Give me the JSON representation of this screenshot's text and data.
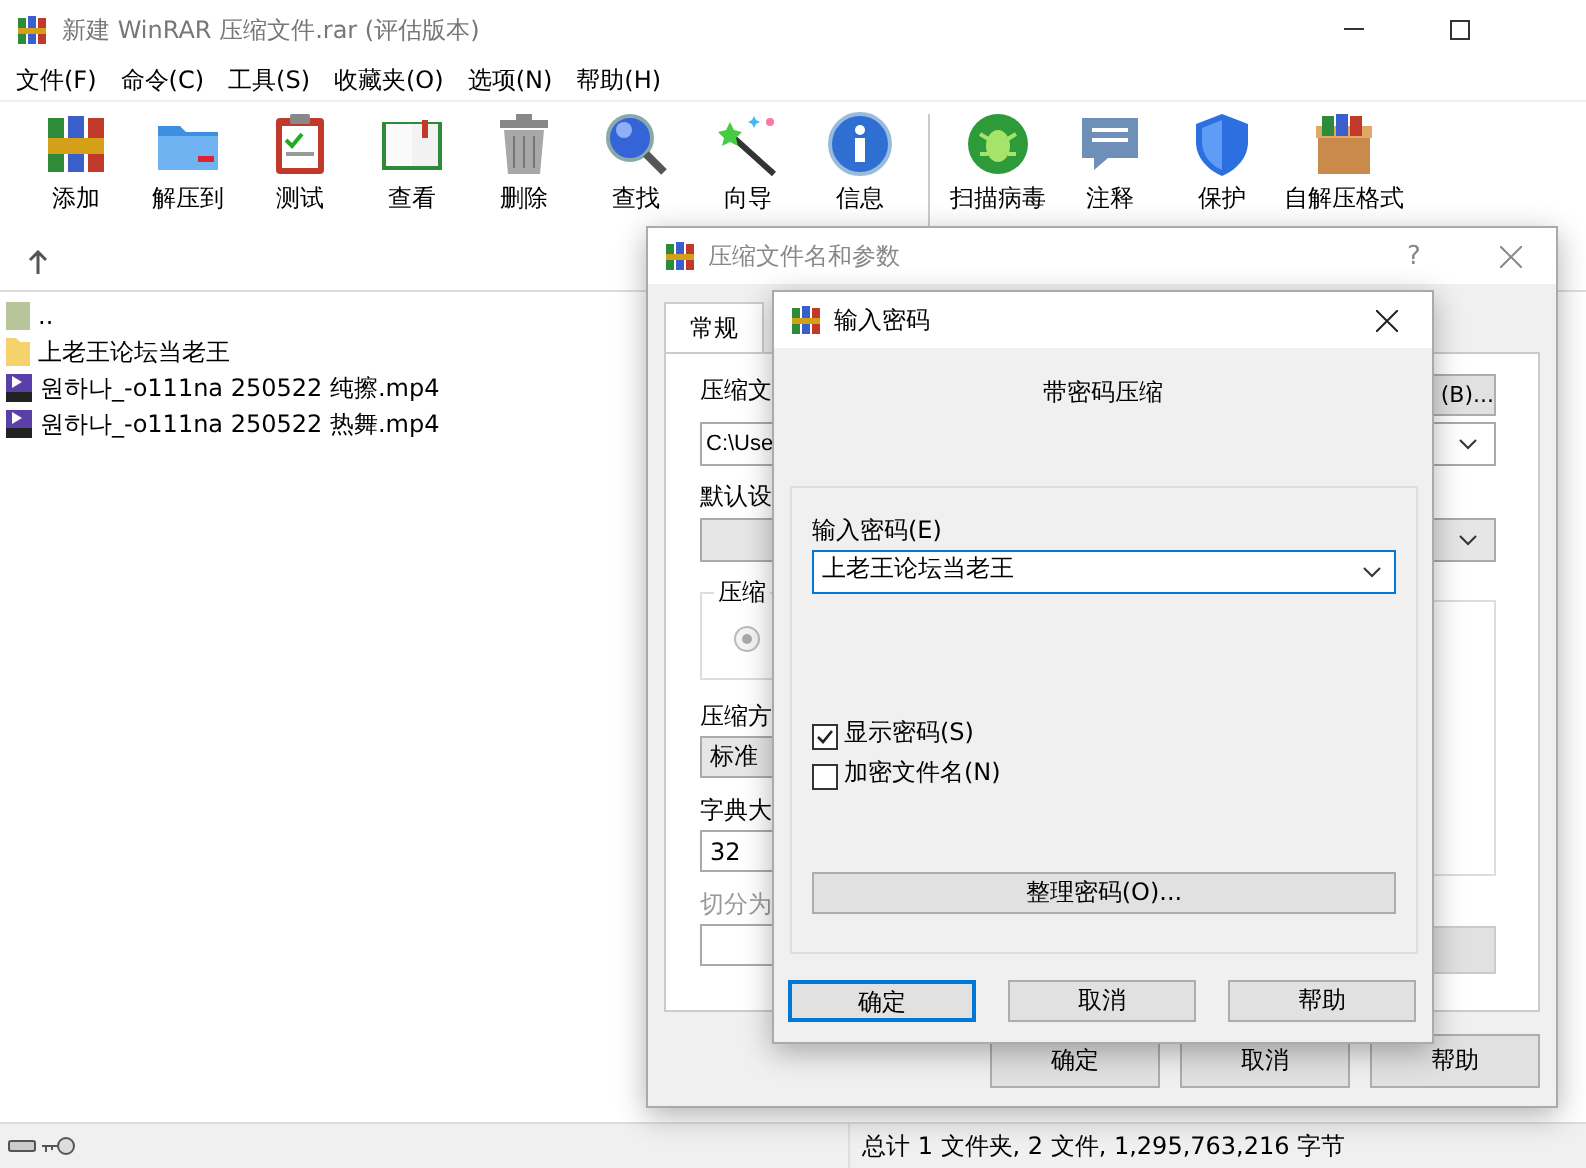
{
  "window": {
    "title": "新建 WinRAR 压缩文件.rar (评估版本)"
  },
  "menu": [
    "文件(F)",
    "命令(C)",
    "工具(S)",
    "收藏夹(O)",
    "选项(N)",
    "帮助(H)"
  ],
  "toolbar_groups": [
    [
      {
        "label": "添加"
      },
      {
        "label": "解压到"
      },
      {
        "label": "测试"
      },
      {
        "label": "查看"
      },
      {
        "label": "删除"
      },
      {
        "label": "查找"
      },
      {
        "label": "向导"
      },
      {
        "label": "信息"
      }
    ],
    [
      {
        "label": "扫描病毒"
      },
      {
        "label": "注释"
      },
      {
        "label": "保护"
      },
      {
        "label": "自解压格式"
      }
    ]
  ],
  "files": [
    {
      "name": "..",
      "kind": "parent"
    },
    {
      "name": "上老王论坛当老王",
      "kind": "folder"
    },
    {
      "name": "원하나_-o111na 250522 纯擦.mp4",
      "kind": "video"
    },
    {
      "name": "원하나_-o111na 250522 热舞.mp4",
      "kind": "video"
    }
  ],
  "status_bar": {
    "summary": "总计 1 文件夹, 2 文件, 1,295,763,216 字节"
  },
  "archive_dialog": {
    "title": "压缩文件名和参数",
    "help": "?",
    "tabs": [
      {
        "label": "常规",
        "selected": true
      }
    ],
    "archive_label": "压缩文",
    "browse_button": "(B)...",
    "archive_path": "C:\\Use",
    "profile_label": "默认设",
    "group_label": "压缩",
    "radio": {
      "selected": true
    },
    "method_label": "压缩方",
    "method_value": "标准",
    "dict_label": "字典大",
    "dict_value": "32",
    "split_label": "切分为",
    "split_disabled": true,
    "buttons": [
      "确定",
      "取消",
      "帮助"
    ]
  },
  "password_dialog": {
    "title": "输入密码",
    "heading": "带密码压缩",
    "password_label": "输入密码(E)",
    "password_value": "上老王论坛当老王",
    "options": [
      {
        "label": "显示密码(S)",
        "checked": true
      },
      {
        "label": "加密文件名(N)",
        "checked": false
      }
    ],
    "organize_button": "整理密码(O)...",
    "buttons": [
      {
        "label": "确定",
        "default": true
      },
      {
        "label": "取消",
        "default": false
      },
      {
        "label": "帮助",
        "default": false
      }
    ]
  }
}
